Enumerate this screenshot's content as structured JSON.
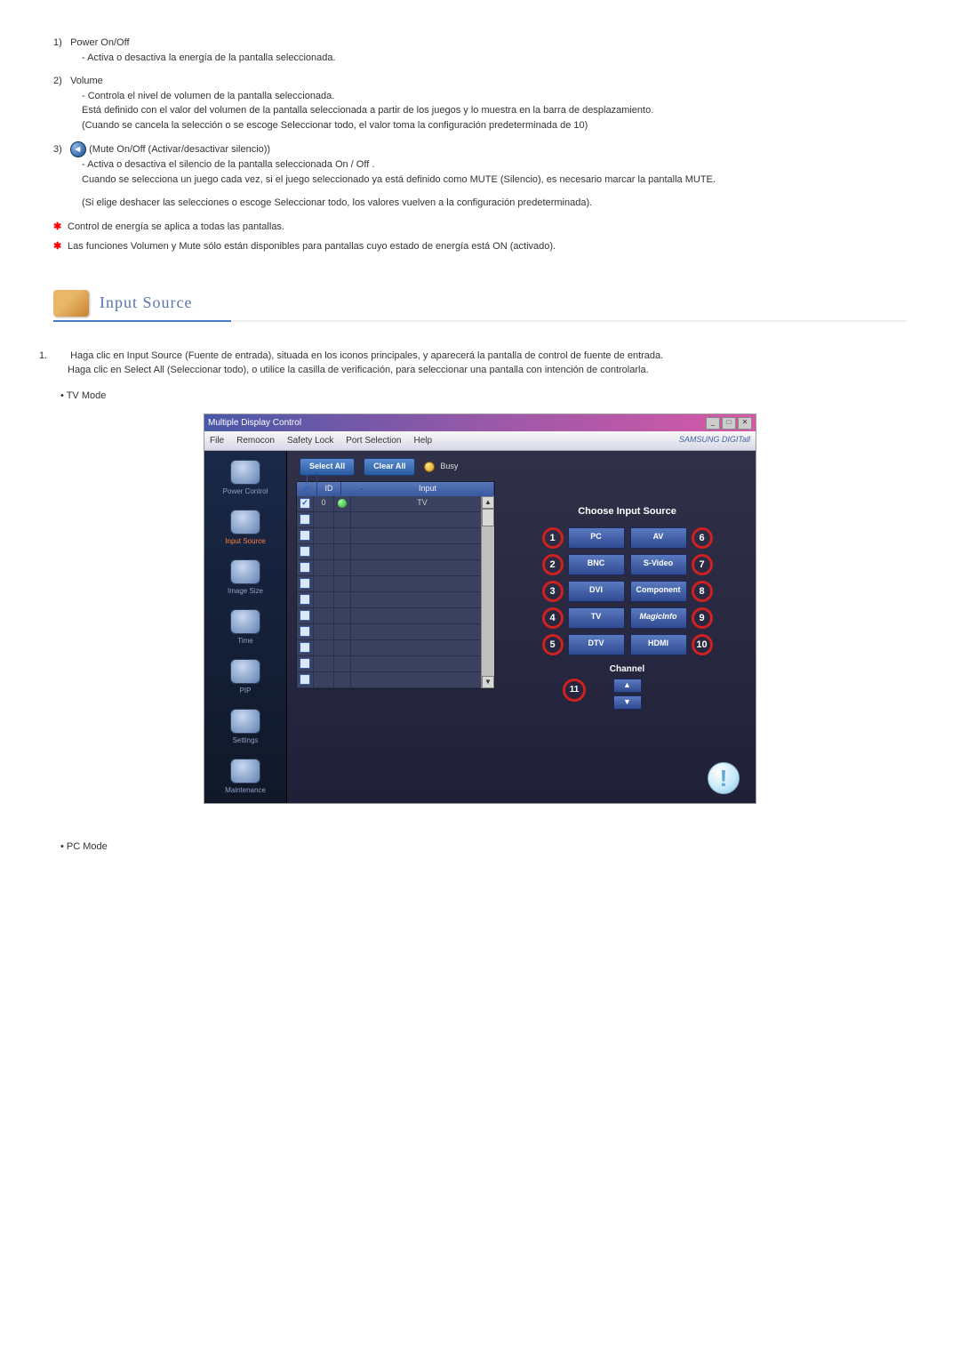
{
  "item1": {
    "num": "1)",
    "title": "Power On/Off",
    "line1": "- Activa o desactiva la energía de la pantalla seleccionada."
  },
  "item2": {
    "num": "2)",
    "title": "Volume",
    "l1": "- Controla el nivel de volumen de la pantalla seleccionada.",
    "l2": "Está definido con el valor del volumen de la pantalla seleccionada a partir de los juegos y lo muestra en la barra de desplazamiento.",
    "l3": "(Cuando se cancela la selección o se escoge Seleccionar todo, el valor toma la configuración predeterminada de 10)"
  },
  "item3": {
    "num": "3)",
    "title": "(Mute On/Off (Activar/desactivar silencio))",
    "l1": "- Activa o desactiva el silencio de la pantalla seleccionada On / Off .",
    "l2": "Cuando se selecciona un juego cada vez, si el juego seleccionado ya está definido como MUTE (Silencio), es necesario marcar la pantalla MUTE.",
    "l3": "(Si elige deshacer las selecciones o escoge Seleccionar todo, los valores vuelven a la configuración predeterminada)."
  },
  "star1": "Control de energía se aplica a todas las pantallas.",
  "star2": "Las funciones Volumen y Mute sólo están disponibles para pantallas cuyo estado de energía está ON (activado).",
  "section_title": "Input Source",
  "intro_num": "1.",
  "intro_l1": "Haga clic en Input Source (Fuente de entrada), situada en los iconos principales, y aparecerá la pantalla de control de fuente de entrada.",
  "intro_l2": "Haga clic en Select All (Seleccionar todo), o utilice la casilla de verificación, para seleccionar una pantalla con intención de controlarla.",
  "bullet_tv": "• TV Mode",
  "bullet_pc": "• PC Mode",
  "app": {
    "title": "Multiple Display Control",
    "menu": {
      "file": "File",
      "remocon": "Remocon",
      "safety": "Safety Lock",
      "port": "Port Selection",
      "help": "Help"
    },
    "brand": "SAMSUNG DIGITall",
    "sidebar": {
      "power": "Power Control",
      "input": "Input Source",
      "image": "Image Size",
      "time": "Time",
      "pip": "PIP",
      "settings": "Settings",
      "maint": "Maintenance"
    },
    "select_all": "Select All",
    "clear_all": "Clear All",
    "busy": "Busy",
    "th_id": "ID",
    "th_input": "Input",
    "row0_id": "0",
    "row0_input": "TV",
    "panel_title": "Choose Input Source",
    "src": {
      "pc": "PC",
      "av": "AV",
      "bnc": "BNC",
      "svideo": "S-Video",
      "dvi": "DVI",
      "component": "Component",
      "tv": "TV",
      "magicinfo": "MagicInfo",
      "dtv": "DTV",
      "hdmi": "HDMI"
    },
    "channel": "Channel",
    "nums": {
      "n1": "1",
      "n2": "2",
      "n3": "3",
      "n4": "4",
      "n5": "5",
      "n6": "6",
      "n7": "7",
      "n8": "8",
      "n9": "9",
      "n10": "10",
      "n11": "11"
    },
    "info": "!"
  }
}
